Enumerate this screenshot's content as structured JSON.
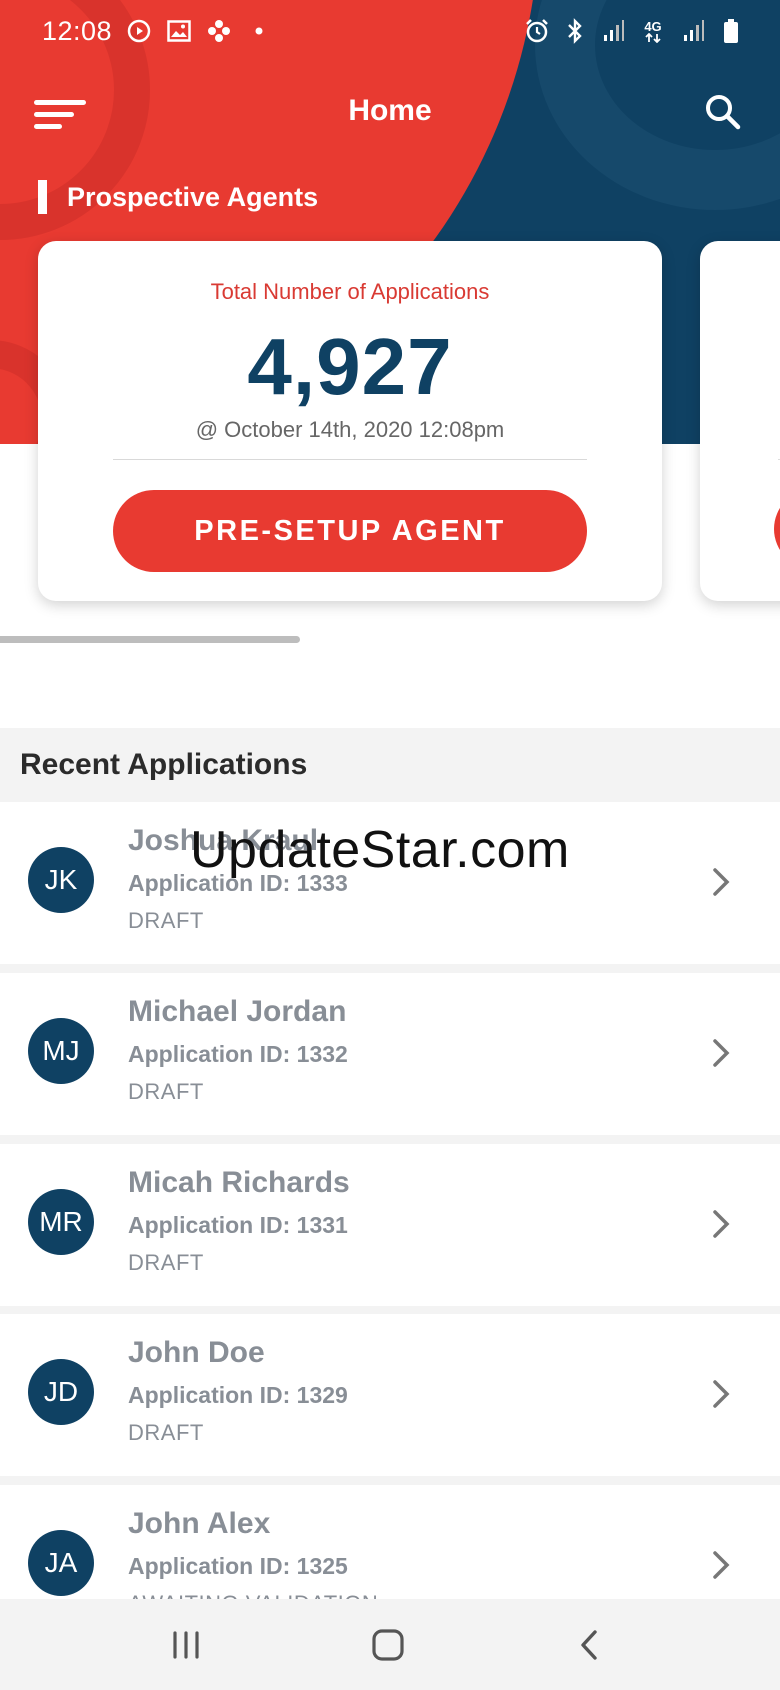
{
  "status_bar": {
    "time": "12:08",
    "network_label": "4G"
  },
  "app_bar": {
    "title": "Home"
  },
  "section": {
    "title": "Prospective Agents"
  },
  "summary_card": {
    "label": "Total Number of Applications",
    "value": "4,927",
    "timestamp": "@ October 14th, 2020 12:08pm",
    "button_label": "PRE-SETUP AGENT"
  },
  "recent": {
    "title": "Recent Applications",
    "items": [
      {
        "initials": "JK",
        "name": "Joshua Kraul",
        "app_id": "Application ID: 1333",
        "status": "DRAFT"
      },
      {
        "initials": "MJ",
        "name": "Michael Jordan",
        "app_id": "Application ID: 1332",
        "status": "DRAFT"
      },
      {
        "initials": "MR",
        "name": "Micah Richards",
        "app_id": "Application ID: 1331",
        "status": "DRAFT"
      },
      {
        "initials": "JD",
        "name": "John Doe",
        "app_id": "Application ID: 1329",
        "status": "DRAFT"
      },
      {
        "initials": "JA",
        "name": "John Alex",
        "app_id": "Application ID: 1325",
        "status": "AWAITING VALIDATION"
      }
    ]
  },
  "watermark": "UpdateStar.com",
  "colors": {
    "brand_red": "#e83a31",
    "brand_navy": "#0f4163",
    "text_muted": "#888e96"
  },
  "icons": {
    "menu": "menu-icon",
    "search": "search-icon",
    "chevron": "chevron-right-icon",
    "nav_recents": "recents-icon",
    "nav_home": "home-icon",
    "nav_back": "back-icon"
  }
}
